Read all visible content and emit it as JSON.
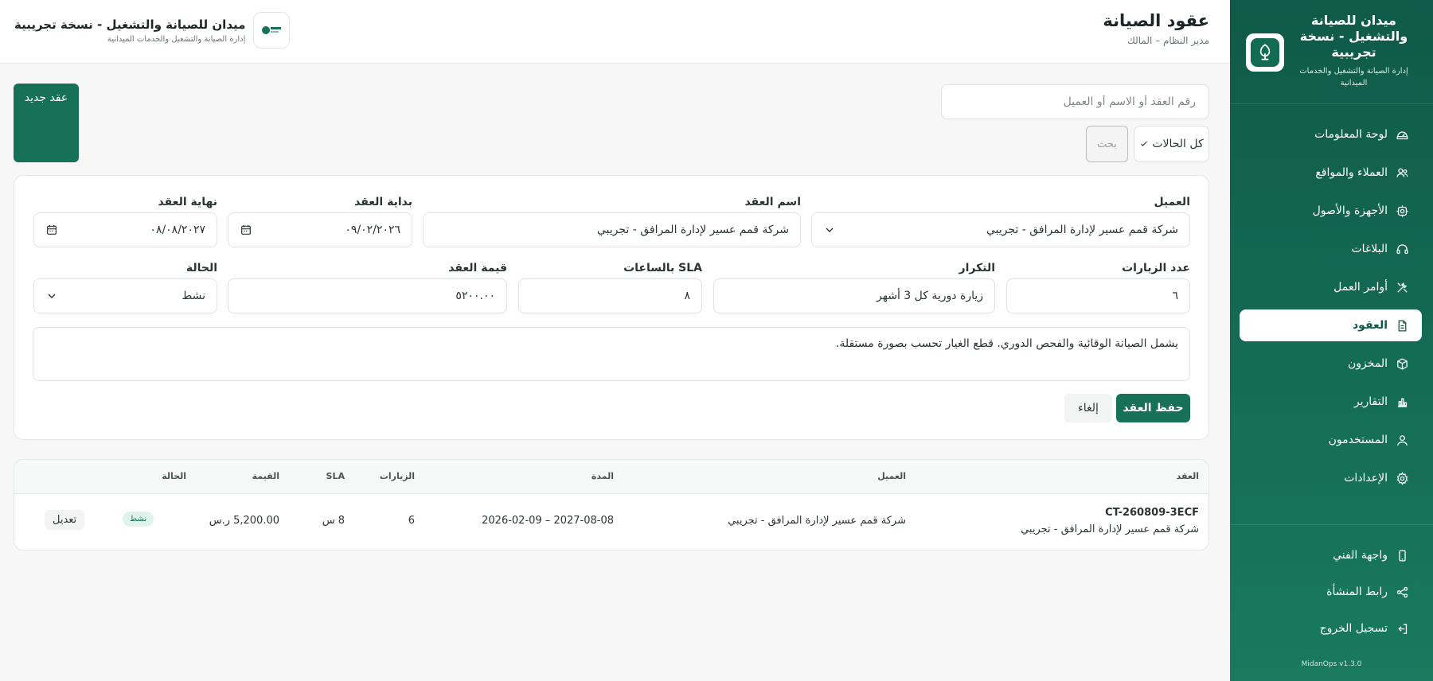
{
  "sidebar": {
    "brand_title": "ميدان للصيانة والتشغيل - نسخة تجريبية",
    "brand_subtitle": "إدارة الصيانة والتشغيل والخدمات الميدانية",
    "items": [
      {
        "label": "لوحة المعلومات",
        "icon": "dashboard-icon"
      },
      {
        "label": "العملاء والمواقع",
        "icon": "users-icon"
      },
      {
        "label": "الأجهزة والأصول",
        "icon": "device-icon"
      },
      {
        "label": "البلاغات",
        "icon": "headset-icon"
      },
      {
        "label": "أوامر العمل",
        "icon": "tools-icon"
      },
      {
        "label": "العقود",
        "icon": "document-icon"
      },
      {
        "label": "المخزون",
        "icon": "box-icon"
      },
      {
        "label": "التقارير",
        "icon": "chart-icon"
      },
      {
        "label": "المستخدمون",
        "icon": "user-icon"
      },
      {
        "label": "الإعدادات",
        "icon": "gear-icon"
      }
    ],
    "bottom_items": [
      {
        "label": "واجهة الفني",
        "icon": "phone-icon"
      },
      {
        "label": "رابط المنشأة",
        "icon": "share-icon"
      },
      {
        "label": "تسجيل الخروج",
        "icon": "logout-icon"
      }
    ],
    "version": "MidanOps v1.3.0"
  },
  "topbar": {
    "title": "عقود الصيانة",
    "subtitle": "مدير النظام – المالك",
    "brand_title": "ميدان للصيانة والتشغيل - نسخة تجريبية",
    "brand_subtitle": "إدارة الصيانة والتشغيل والخدمات الميدانية"
  },
  "toolbar": {
    "search_placeholder": "رقم العقد أو الاسم أو العميل",
    "status_filter": "كل الحالات",
    "search_label": "بحث",
    "new_contract_label": "عقد جديد"
  },
  "form": {
    "client_label": "العميل",
    "client_value": "شركة قمم عسير لإدارة المرافق - تجريبي",
    "name_label": "اسم العقد",
    "name_value": "شركة قمم عسير لإدارة المرافق - تجريبي",
    "start_label": "بداية العقد",
    "start_value": "٠٩/٠٢/٢٠٢٦",
    "end_label": "نهاية العقد",
    "end_value": "٠٨/٠٨/٢٠٢٧",
    "visits_label": "عدد الزيارات",
    "visits_value": "٦",
    "frequency_label": "التكرار",
    "frequency_value": "زيارة دورية كل 3 أشهر",
    "sla_label": "SLA بالساعات",
    "sla_value": "٨",
    "value_label": "قيمة العقد",
    "value_value": "٥٢٠٠.٠٠",
    "status_label": "الحالة",
    "status_value": "نشط",
    "notes_value": "يشمل الصيانة الوقائية والفحص الدوري. قطع الغيار تحسب بصورة مستقلة.",
    "save_label": "حفظ العقد",
    "cancel_label": "إلغاء"
  },
  "table": {
    "headers": {
      "contract": "العقد",
      "client": "العميل",
      "period": "المدة",
      "visits": "الزيارات",
      "sla": "SLA",
      "value": "القيمة",
      "status": "الحالة"
    },
    "rows": [
      {
        "code": "CT-260809-3ECF",
        "contract_name": "شركة قمم عسير لإدارة المرافق - تجريبي",
        "client": "شركة قمم عسير لإدارة المرافق - تجريبي",
        "period": "2026-02-09 – 2027-08-08",
        "visits": "6",
        "sla": "8 س",
        "value": "5,200.00 ر.س",
        "status": "نشط",
        "edit_label": "تعديل"
      }
    ]
  },
  "colors": {
    "brand": "#177058",
    "sidebar_top": "#0f5a48",
    "badge_bg": "#dff3ea"
  }
}
